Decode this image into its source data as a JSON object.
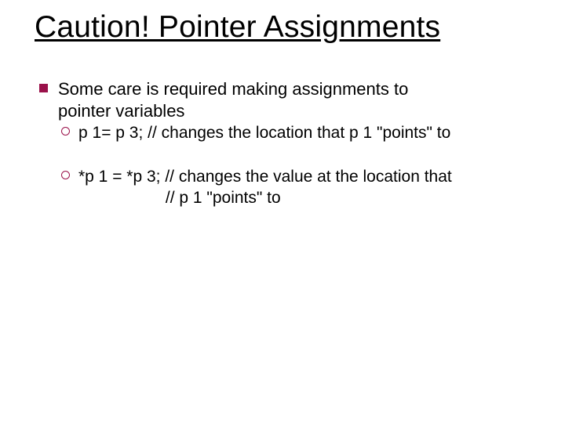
{
  "title": "Caution! Pointer Assignments",
  "bullets": {
    "l1_line1": "Some care is required making assignments to",
    "l1_line2": "pointer variables",
    "l2a": "p 1= p 3; // changes the location that p 1 \"points\" to",
    "l2b": "*p 1 = *p 3; // changes the value at the location that",
    "l2b_cont": "// p 1 \"points\" to"
  }
}
